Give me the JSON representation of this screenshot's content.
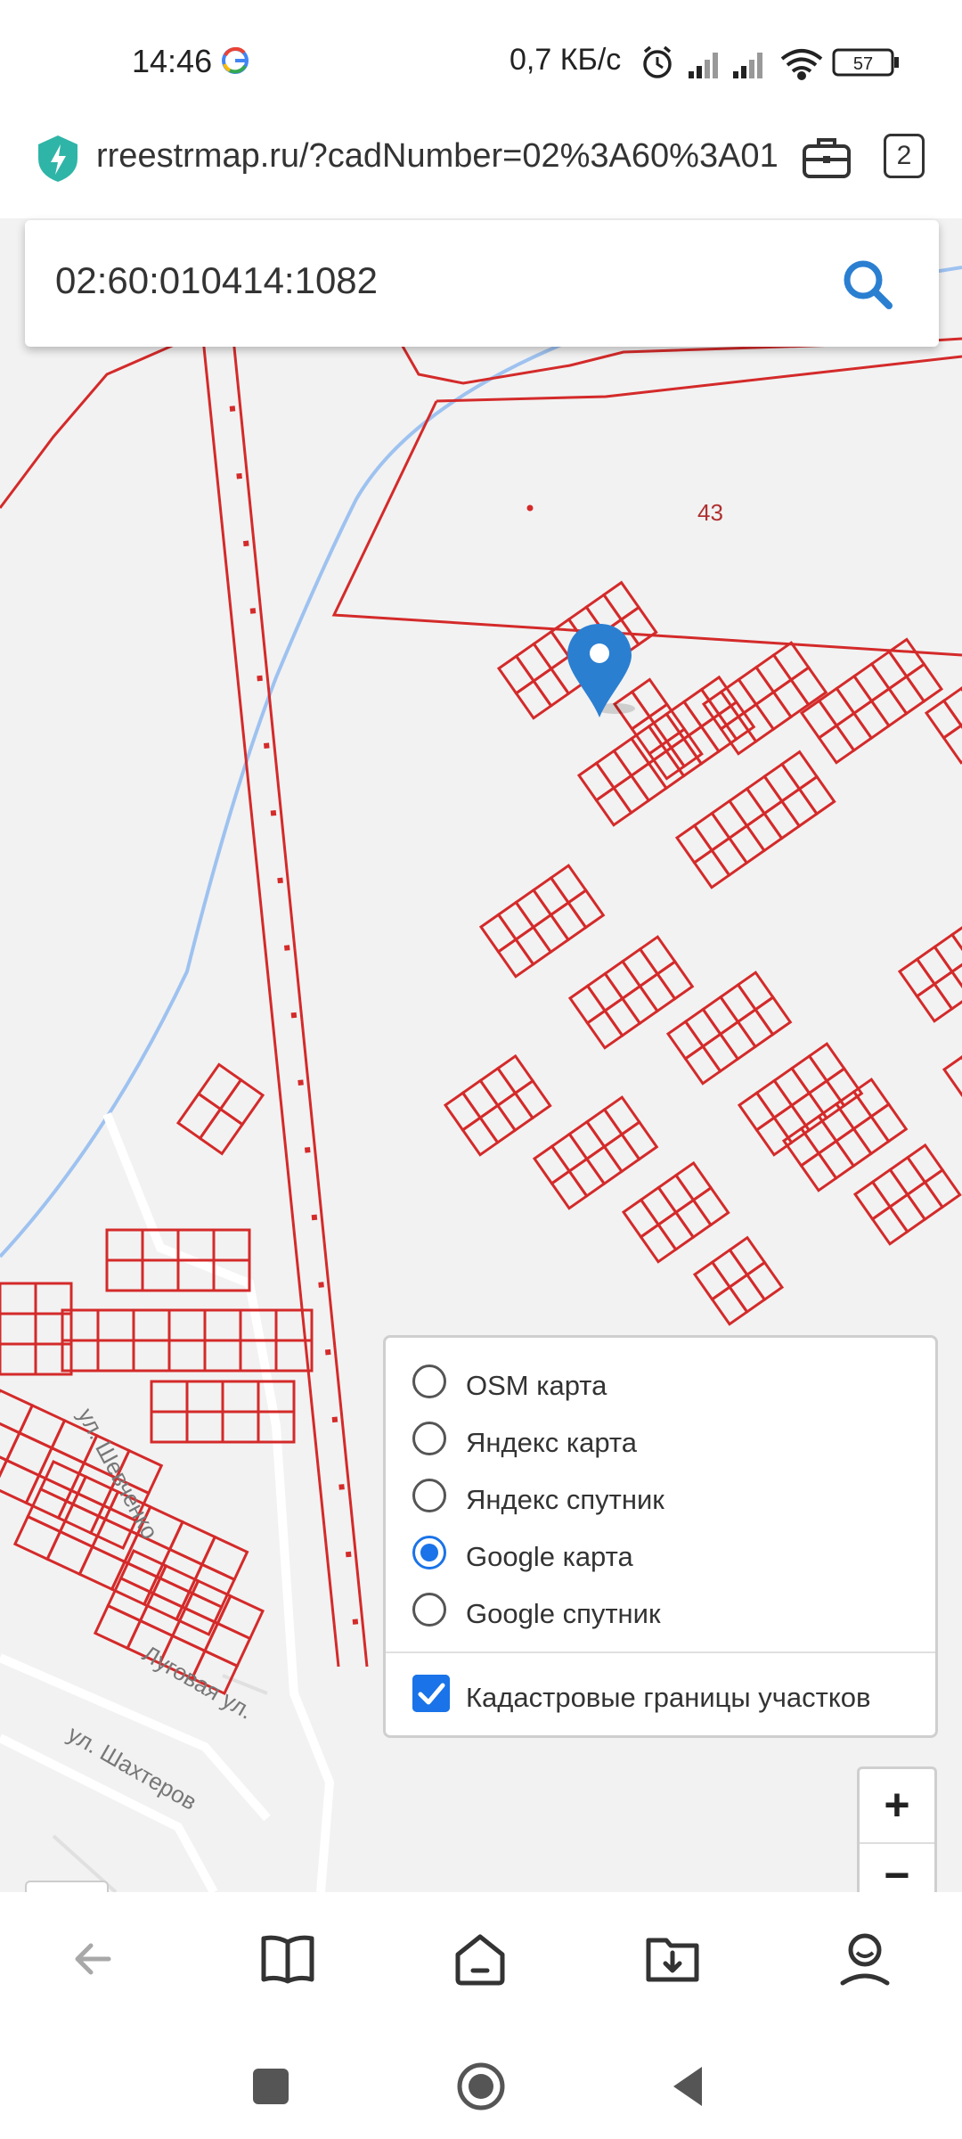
{
  "status_bar": {
    "time": "14:46",
    "net_speed": "0,7 КБ/с",
    "battery": "57"
  },
  "browser": {
    "url": "rreestrmap.ru/?cadNumber=02%3A60%3A01",
    "tabs_count": "2"
  },
  "search": {
    "value": "02:60:010414:1082"
  },
  "map": {
    "parcel_label": "43",
    "streets": [
      "ул. Шевченко",
      "Луговая ул.",
      "ул. Шахтеров"
    ],
    "boundary_color": "#d42a2a",
    "water_color": "#9ec2f0",
    "marker_color": "#2b7fd1"
  },
  "layers": {
    "options": [
      {
        "label": "OSM карта",
        "selected": false
      },
      {
        "label": "Яндекс карта",
        "selected": false
      },
      {
        "label": "Яндекс спутник",
        "selected": false
      },
      {
        "label": "Google карта",
        "selected": true
      },
      {
        "label": "Google спутник",
        "selected": false
      }
    ],
    "overlay_label": "Кадастровые границы участков",
    "overlay_checked": true
  },
  "zoom": {
    "in_label": "+",
    "out_label": "−"
  },
  "toolbar": {
    "icons": [
      "back-icon",
      "book-icon",
      "home-icon",
      "downloads-icon",
      "profile-icon"
    ]
  },
  "nav": {
    "icons": [
      "recents-icon",
      "home-circle-icon",
      "back-triangle-icon"
    ]
  }
}
